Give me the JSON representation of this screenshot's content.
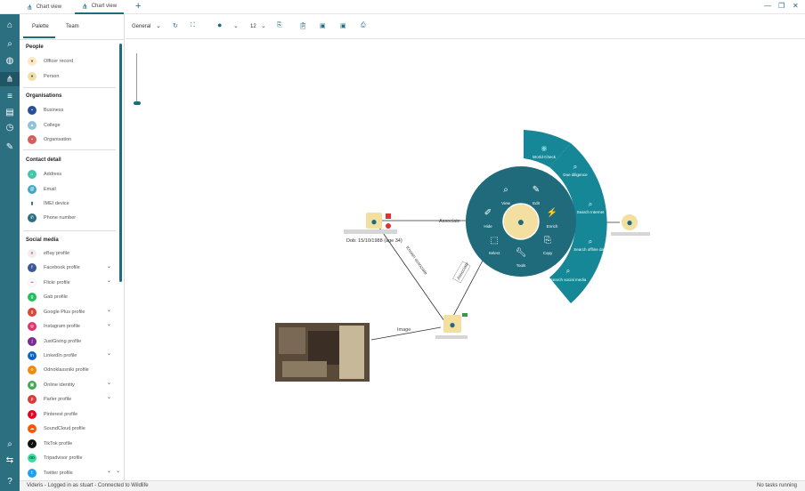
{
  "tabs": [
    {
      "label": "Chart view",
      "active": false
    },
    {
      "label": "Chart view",
      "active": true
    }
  ],
  "palette": {
    "tabs": [
      "Palette",
      "Team"
    ],
    "sections": {
      "people": "People",
      "orgs": "Organisations",
      "contact": "Contact detail",
      "social": "Social media"
    },
    "people": [
      "Officer record",
      "Person"
    ],
    "orgs": [
      "Business",
      "College",
      "Organisation"
    ],
    "contact": [
      "Address",
      "Email",
      "IMEI device",
      "Phone number"
    ],
    "social": [
      "eBay profile",
      "Facebook profile",
      "Flickr profile",
      "Gab profile",
      "Google Plus profile",
      "Instagram profile",
      "JustGiving profile",
      "LinkedIn profile",
      "Odnoklassniki profile",
      "Online identity",
      "Parler profile",
      "Pinterest profile",
      "SoundCloud profile",
      "TikTok profile",
      "Tripadvisor profile",
      "Twitter profile"
    ]
  },
  "toolbar": {
    "layout": "General",
    "fontsize": "12"
  },
  "chart": {
    "node_dob": "Dob: 15/10/1988 (age 34)",
    "edge_associate_1": "Associate",
    "edge_associate_2": "Associate",
    "edge_image": "Image",
    "edge_known": "Known associate",
    "menu": {
      "inner": [
        "View",
        "Edit",
        "Hide",
        "Enrich",
        "Select",
        "Copy",
        "Tools"
      ],
      "outer": [
        "World-Check",
        "Due diligence",
        "Search Internet",
        "Search offline data",
        "Search social media"
      ]
    }
  },
  "status": {
    "left": "Videris - Logged in as stuart - Connected to Wildlife",
    "right": "No tasks running"
  },
  "colors": {
    "accent": "#1e6b80",
    "menu_inner": "#1f6b7c",
    "menu_outer": "#158796",
    "node": "#f3e0a0"
  }
}
